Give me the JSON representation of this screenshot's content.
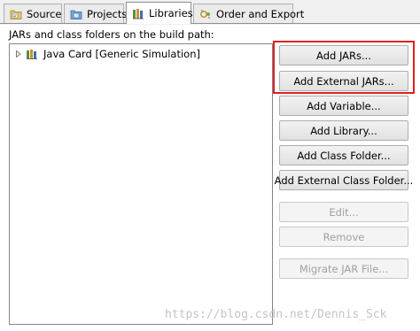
{
  "tabs": [
    {
      "label": "Source",
      "icon": "source-folder-icon",
      "active": false
    },
    {
      "label": "Projects",
      "icon": "projects-icon",
      "active": false
    },
    {
      "label": "Libraries",
      "icon": "libraries-icon",
      "active": true
    },
    {
      "label": "Order and Export",
      "icon": "order-export-icon",
      "active": false
    }
  ],
  "path_label": "JARs and class folders on the build path:",
  "tree": {
    "items": [
      {
        "label": "Java Card [Generic Simulation]",
        "icon": "library-container-icon",
        "expanded": false
      }
    ]
  },
  "buttons": [
    {
      "label": "Add JARs...",
      "enabled": true
    },
    {
      "label": "Add External JARs...",
      "enabled": true
    },
    {
      "label": "Add Variable...",
      "enabled": true
    },
    {
      "label": "Add Library...",
      "enabled": true
    },
    {
      "label": "Add Class Folder...",
      "enabled": true
    },
    {
      "label": "Add External Class Folder...",
      "enabled": true
    },
    {
      "label": "Edit...",
      "enabled": false
    },
    {
      "label": "Remove",
      "enabled": false
    },
    {
      "label": "Migrate JAR File...",
      "enabled": false
    }
  ],
  "highlight_color": "#e02020",
  "watermark": "https://blog.csdn.net/Dennis_Sck"
}
